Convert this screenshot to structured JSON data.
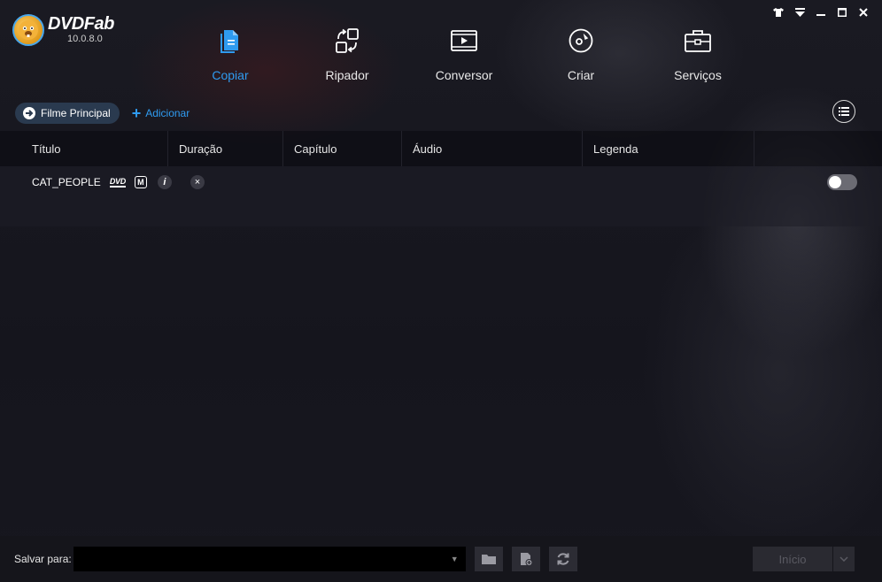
{
  "app": {
    "name": "DVDFab",
    "version": "10.0.8.0"
  },
  "window_controls": {
    "icons": [
      "shirt-icon",
      "menu-down-icon",
      "minimize-icon",
      "maximize-icon",
      "close-icon"
    ]
  },
  "nav": {
    "items": [
      {
        "label": "Copiar",
        "icon": "copy-icon",
        "active": true
      },
      {
        "label": "Ripador",
        "icon": "ripper-icon",
        "active": false
      },
      {
        "label": "Conversor",
        "icon": "converter-icon",
        "active": false
      },
      {
        "label": "Criar",
        "icon": "disc-create-icon",
        "active": false
      },
      {
        "label": "Serviços",
        "icon": "toolbox-icon",
        "active": false
      }
    ]
  },
  "toolbar": {
    "mode_label": "Filme Principal",
    "add_label": "Adicionar"
  },
  "table": {
    "columns": [
      "Título",
      "Duração",
      "Capítulo",
      "Áudio",
      "Legenda"
    ],
    "rows": [
      {
        "title": "CAT_PEOPLE",
        "dvd_badge": "DVD",
        "m_badge": "M",
        "info": "i",
        "remove": "×",
        "enabled": false
      }
    ]
  },
  "bottom": {
    "save_label": "Salvar para:",
    "path_value": "",
    "start_label": "Início"
  },
  "colors": {
    "accent": "#2f9bf0",
    "background": "#15151c"
  }
}
